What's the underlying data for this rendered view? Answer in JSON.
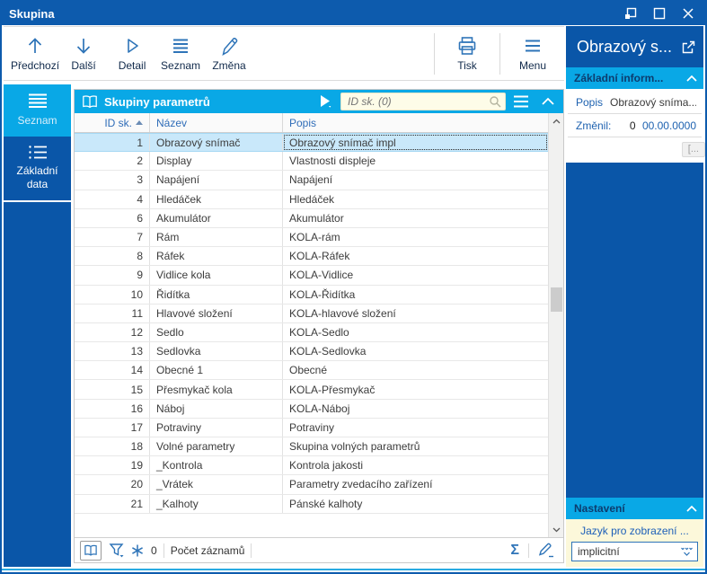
{
  "window": {
    "title": "Skupina"
  },
  "toolbar": {
    "items": [
      {
        "label": "Předchozí",
        "icon": "arrow-up-icon"
      },
      {
        "label": "Další",
        "icon": "arrow-down-icon"
      },
      {
        "label": "Detail",
        "icon": "play-outline-icon"
      },
      {
        "label": "Seznam",
        "icon": "list-icon"
      },
      {
        "label": "Změna",
        "icon": "pencil-icon"
      }
    ],
    "right_items": [
      {
        "label": "Tisk",
        "icon": "printer-icon"
      },
      {
        "label": "Menu",
        "icon": "menu-icon"
      }
    ]
  },
  "sidebar": {
    "tabs": [
      {
        "label": "Seznam",
        "active": true
      },
      {
        "label": "Základní data",
        "active": false
      }
    ]
  },
  "list": {
    "header": {
      "title": "Skupiny parametrů"
    },
    "search": {
      "placeholder": "ID sk. (0)",
      "value": ""
    },
    "columns": [
      {
        "label": "ID sk.",
        "sorted": "asc"
      },
      {
        "label": "Název"
      },
      {
        "label": "Popis"
      }
    ],
    "rows": [
      [
        "1",
        "Obrazový snímač",
        "Obrazový snímač impl"
      ],
      [
        "2",
        "Display",
        "Vlastnosti displeje"
      ],
      [
        "3",
        "Napájení",
        "Napájení"
      ],
      [
        "4",
        "Hledáček",
        "Hledáček"
      ],
      [
        "6",
        "Akumulátor",
        "Akumulátor"
      ],
      [
        "7",
        "Rám",
        "KOLA-rám"
      ],
      [
        "8",
        "Ráfek",
        "KOLA-Ráfek"
      ],
      [
        "9",
        "Vidlice kola",
        "KOLA-Vidlice"
      ],
      [
        "10",
        "Řidítka",
        "KOLA-Řidítka"
      ],
      [
        "11",
        "Hlavové složení",
        "KOLA-hlavové složení"
      ],
      [
        "12",
        "Sedlo",
        "KOLA-Sedlo"
      ],
      [
        "13",
        "Sedlovka",
        "KOLA-Sedlovka"
      ],
      [
        "14",
        "Obecné 1",
        "Obecné"
      ],
      [
        "15",
        "Přesmykač kola",
        "KOLA-Přesmykač"
      ],
      [
        "16",
        "Náboj",
        "KOLA-Náboj"
      ],
      [
        "17",
        "Potraviny",
        "Potraviny"
      ],
      [
        "18",
        "Volné parametry",
        "Skupina volných parametrů"
      ],
      [
        "19",
        "_Kontrola",
        "Kontrola jakosti"
      ],
      [
        "20",
        "_Vrátek",
        "Parametry zvedacího zařízení"
      ],
      [
        "21",
        "_Kalhoty",
        "Pánské kalhoty"
      ]
    ],
    "selected_index": 0,
    "status": {
      "count_value": "0",
      "count_label": "Počet záznamů"
    }
  },
  "right_panel": {
    "title": "Obrazový s...",
    "basic": {
      "header": "Základní inform...",
      "popis_label": "Popis",
      "popis_value": "Obrazový sníma...",
      "changed_label": "Změnil:",
      "changed_num": "0",
      "changed_date": "00.00.0000",
      "more_label": "[..."
    },
    "settings": {
      "header": "Nastavení",
      "field_label": "Jazyk pro zobrazení ...",
      "combo_value": "implicitní"
    }
  },
  "colors": {
    "title_blue": "#0d5bad",
    "panel_blue": "#0a56a8",
    "accent_cyan": "#09a8e6",
    "selected_row": "#c9e8fa",
    "icon_blue": "#2e74b8",
    "search_yellow": "#fdfce8",
    "settings_yellow": "#fcf8da"
  }
}
